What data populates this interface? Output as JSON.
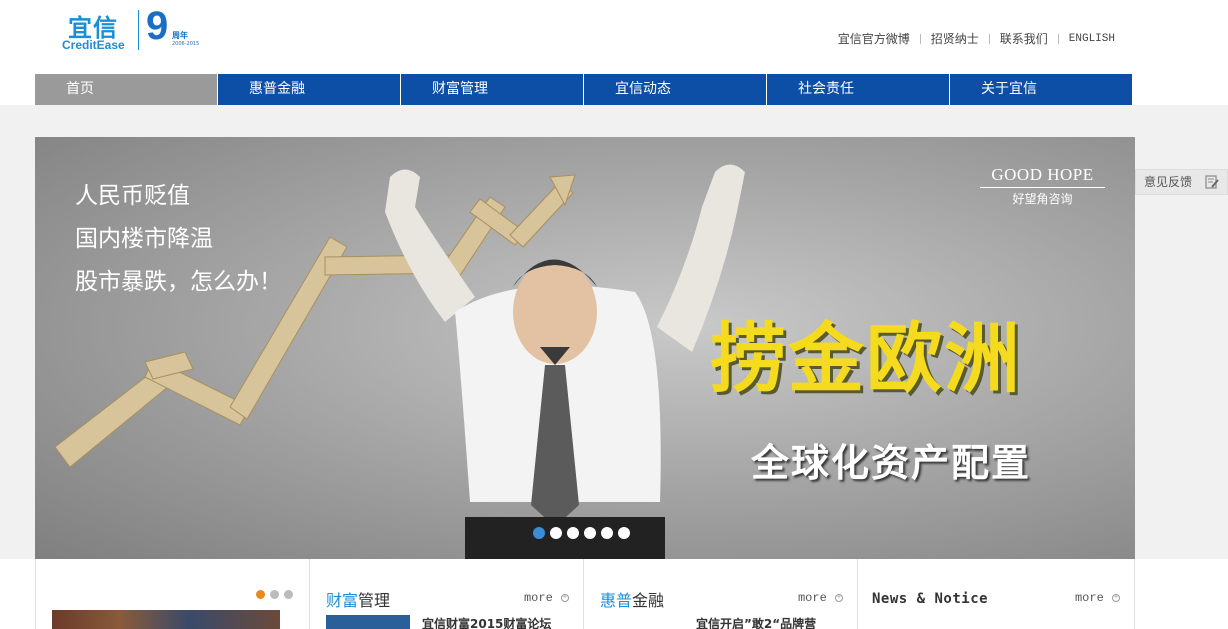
{
  "header": {
    "logo_cn": "宜信",
    "logo_en": "CreditEase",
    "logo_nine": "9",
    "logo_anniv": "周年",
    "logo_years": "2006-2015",
    "links": [
      "宜信官方微博",
      "招贤纳士",
      "联系我们",
      "ENGLISH"
    ]
  },
  "nav": {
    "items": [
      "首页",
      "惠普金融",
      "财富管理",
      "宜信动态",
      "社会责任",
      "关于宜信"
    ]
  },
  "banner": {
    "left_lines": [
      "人民币贬值",
      "国内楼市降温",
      "股市暴跌，怎么办！"
    ],
    "brand_en": "GOOD HOPE",
    "brand_cn": "好望角咨询",
    "headline": "捞金欧洲",
    "subline": "全球化资产配置",
    "slides_count": 6,
    "active_slide": 1
  },
  "feedback": {
    "label": "意见反馈"
  },
  "columns": {
    "wealth": {
      "title_hl": "财富",
      "title_rest": "管理",
      "more": "more",
      "item": "宜信财富2015财富论坛"
    },
    "puhui": {
      "title_hl": "惠普",
      "title_rest": "金融",
      "more": "more",
      "item": "宜信开启”敢2“品牌营"
    },
    "news": {
      "title": "News & Notice",
      "more": "more"
    }
  },
  "colors": {
    "nav_blue": "#0d4ea6",
    "nav_active": "#9a9a9a",
    "accent": "#1a8fd8",
    "headline": "#f5db1e"
  }
}
